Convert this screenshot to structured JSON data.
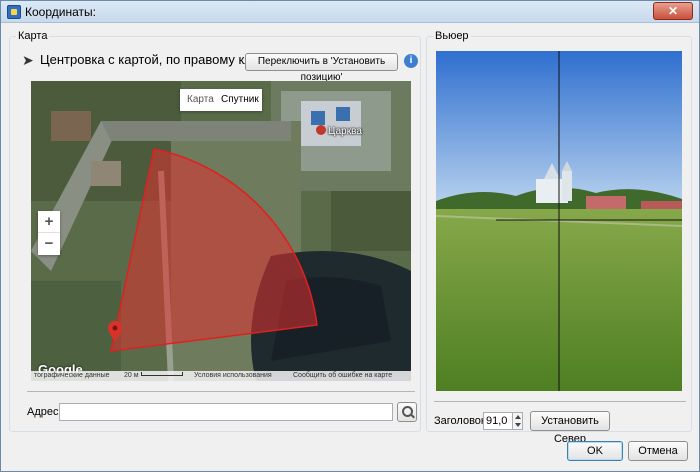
{
  "window": {
    "title": "Координаты:",
    "close_glyph": "✕"
  },
  "map_panel": {
    "group_label": "Карта",
    "hint": "Центровка с картой, по правому клику",
    "switch_button": "Переключить в 'Установить позицию'",
    "info_glyph": "i",
    "map": {
      "type_map": "Карта",
      "type_satellite": "Спутник",
      "zoom_in": "+",
      "zoom_out": "−",
      "poi_label": "Царква",
      "logo": "Google",
      "footer_data": "тографические данные",
      "footer_scale": "20 м",
      "footer_terms": "Условия использования",
      "footer_report": "Сообщить об ошибке на карте"
    },
    "address_label": "Адрес:",
    "address_value": "",
    "address_placeholder": ""
  },
  "viewer_panel": {
    "group_label": "Вьюер",
    "heading_label": "Заголовок:",
    "heading_value": "91,0",
    "set_north_button": "Установить Север"
  },
  "dialog": {
    "ok": "OK",
    "cancel": "Отмена"
  },
  "colors": {
    "view_cone": "#e03030",
    "titlebar": "#c7d9ec",
    "sky": "#4f86d6",
    "grass": "#5c8a2a"
  }
}
